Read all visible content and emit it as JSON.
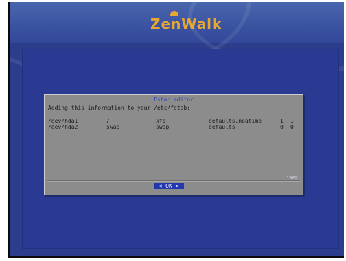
{
  "header": {
    "logo_text": "ZenWalk"
  },
  "dialog": {
    "title": "Fstab editor",
    "message": "Adding this information to your /etc/fstab:",
    "rows": [
      {
        "device": "/dev/hda1",
        "mount": "/",
        "fs": "xfs",
        "options": "defaults,noatime",
        "dump": "1",
        "pass": "1"
      },
      {
        "device": "/dev/hda2",
        "mount": "swap",
        "fs": "swap",
        "options": "defaults",
        "dump": "0",
        "pass": "0"
      }
    ],
    "scroll_indicator": "100%",
    "ok_label": "< OK >"
  },
  "colors": {
    "background": "#2c3d8c",
    "dialog": "#8c8c8c",
    "title": "#2e47b8",
    "button": "#2238b0",
    "logo": "#e8a733"
  }
}
